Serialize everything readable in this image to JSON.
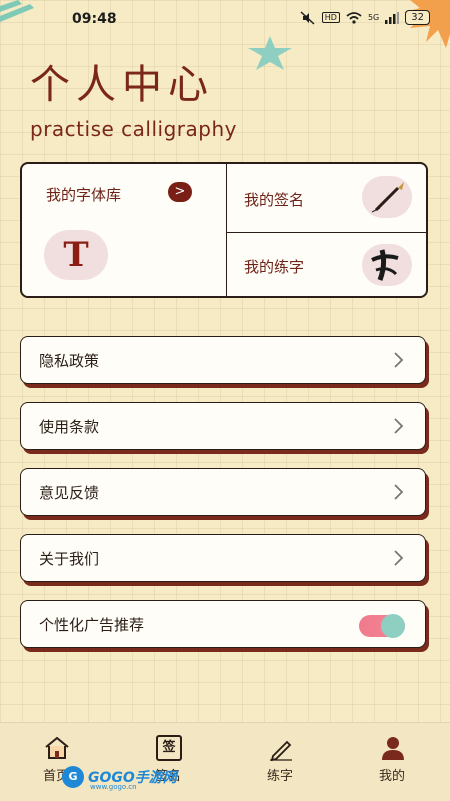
{
  "status_bar": {
    "time": "09:48",
    "network": "HD",
    "signal": "5G",
    "battery": "32"
  },
  "header": {
    "title": "个人中心",
    "subtitle": "practise calligraphy"
  },
  "cards": {
    "font_library": {
      "label": "我的字体库",
      "arrow": ">",
      "icon_letter": "T"
    },
    "signature": {
      "label": "我的签名"
    },
    "practice": {
      "label": "我的练字"
    }
  },
  "menu": {
    "privacy": "隐私政策",
    "terms": "使用条款",
    "feedback": "意见反馈",
    "about": "关于我们",
    "ads": "个性化广告推荐"
  },
  "ads_toggle_on": true,
  "tabbar": {
    "home": "首页",
    "sign": "签名",
    "practice": "练字",
    "mine": "我的",
    "sign_icon_char": "签"
  },
  "watermark": {
    "text": "GOGO手游网",
    "small": "www.gogo.cn",
    "badge": "G"
  },
  "colors": {
    "accent": "#7a2619",
    "background": "#f6ebc4",
    "card": "#fffdf8",
    "toggle": "#f07a8a"
  }
}
